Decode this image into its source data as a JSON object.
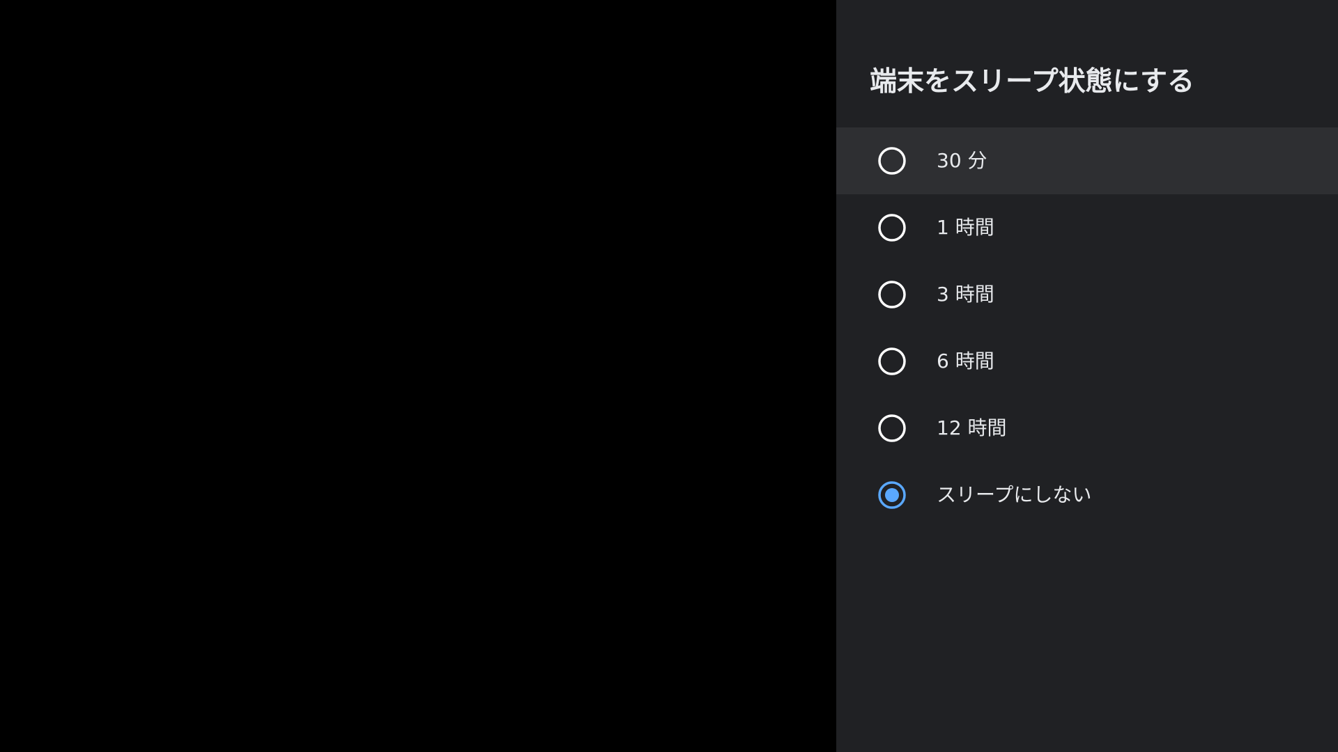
{
  "dialog": {
    "title": "端末をスリープ状態にする"
  },
  "options": [
    {
      "label": "30 分",
      "selected": false,
      "focused": true
    },
    {
      "label": "1 時間",
      "selected": false,
      "focused": false
    },
    {
      "label": "3 時間",
      "selected": false,
      "focused": false
    },
    {
      "label": "6 時間",
      "selected": false,
      "focused": false
    },
    {
      "label": "12 時間",
      "selected": false,
      "focused": false
    },
    {
      "label": "スリープにしない",
      "selected": true,
      "focused": false
    }
  ],
  "colors": {
    "panel_background": "#202124",
    "focused_row": "#2e2f32",
    "accent": "#5aa8ff",
    "radio_ring": "#ffffff",
    "text": "#e8eaed"
  },
  "icons": {
    "radio_unchecked": "radio-unchecked-icon",
    "radio_checked": "radio-checked-icon"
  }
}
